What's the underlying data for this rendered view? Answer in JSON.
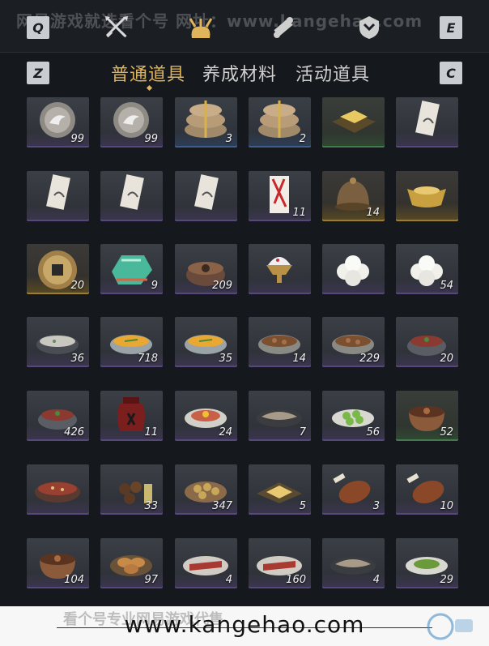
{
  "watermark": "网易游戏就选看个号 网址：www.kangehao.com",
  "keys": {
    "q": "Q",
    "e": "E",
    "z": "Z",
    "c": "C"
  },
  "top_icons": [
    "crossed-swords-icon",
    "bundle-icon",
    "scroll-icon",
    "shield-icon"
  ],
  "tabs": [
    {
      "label": "普通道具",
      "active": true
    },
    {
      "label": "养成材料",
      "active": false
    },
    {
      "label": "活动道具",
      "active": false
    }
  ],
  "colors": {
    "accent": "#e0b45a",
    "rarity_purple": "#8c6ec8",
    "rarity_gold": "#d2aa3c",
    "rarity_green": "#5aaa64"
  },
  "items": [
    {
      "icon": "dove-coin-icon",
      "count": "99",
      "rarity": "purple"
    },
    {
      "icon": "dove-coin-icon",
      "count": "99",
      "rarity": "purple"
    },
    {
      "icon": "rice-bundle-icon",
      "count": "3",
      "rarity": "blue"
    },
    {
      "icon": "rice-bundle-icon",
      "count": "2",
      "rarity": "blue"
    },
    {
      "icon": "golden-cloth-icon",
      "count": "",
      "rarity": "green"
    },
    {
      "icon": "letter-card-icon",
      "count": "",
      "rarity": "purple"
    },
    {
      "icon": "letter-card-icon",
      "count": "",
      "rarity": "purple"
    },
    {
      "icon": "letter-card-icon",
      "count": "",
      "rarity": "purple"
    },
    {
      "icon": "letter-card-icon",
      "count": "",
      "rarity": "purple"
    },
    {
      "icon": "red-envelope-icon",
      "count": "11",
      "rarity": "purple"
    },
    {
      "icon": "bronze-helmet-icon",
      "count": "14",
      "rarity": "gold"
    },
    {
      "icon": "gold-ingot-icon",
      "count": "",
      "rarity": "gold"
    },
    {
      "icon": "square-hole-coin-icon",
      "count": "20",
      "rarity": "gold"
    },
    {
      "icon": "jade-stone-icon",
      "count": "9",
      "rarity": "purple"
    },
    {
      "icon": "stew-pot-icon",
      "count": "209",
      "rarity": "purple"
    },
    {
      "icon": "shaved-ice-icon",
      "count": "",
      "rarity": "purple"
    },
    {
      "icon": "steamed-buns-icon",
      "count": "",
      "rarity": "purple"
    },
    {
      "icon": "steamed-buns-icon",
      "count": "54",
      "rarity": "purple"
    },
    {
      "icon": "porridge-bowl-icon",
      "count": "36",
      "rarity": "purple"
    },
    {
      "icon": "egg-soup-icon",
      "count": "718",
      "rarity": "purple"
    },
    {
      "icon": "egg-soup-icon",
      "count": "35",
      "rarity": "purple"
    },
    {
      "icon": "braised-meat-icon",
      "count": "14",
      "rarity": "purple"
    },
    {
      "icon": "braised-meat-icon",
      "count": "229",
      "rarity": "purple"
    },
    {
      "icon": "meat-bowl-icon",
      "count": "20",
      "rarity": "purple"
    },
    {
      "icon": "meat-bowl-icon",
      "count": "426",
      "rarity": "purple"
    },
    {
      "icon": "wine-jar-icon",
      "count": "11",
      "rarity": "purple"
    },
    {
      "icon": "egg-dish-icon",
      "count": "24",
      "rarity": "purple"
    },
    {
      "icon": "fish-plate-icon",
      "count": "7",
      "rarity": "purple"
    },
    {
      "icon": "okra-plate-icon",
      "count": "56",
      "rarity": "purple"
    },
    {
      "icon": "clay-pot-icon",
      "count": "52",
      "rarity": "green"
    },
    {
      "icon": "hotpot-icon",
      "count": "",
      "rarity": "purple"
    },
    {
      "icon": "pills-icon",
      "count": "33",
      "rarity": "purple"
    },
    {
      "icon": "dumpling-basket-icon",
      "count": "347",
      "rarity": "purple"
    },
    {
      "icon": "noodle-plate-icon",
      "count": "5",
      "rarity": "purple"
    },
    {
      "icon": "meat-leg-icon",
      "count": "3",
      "rarity": "purple"
    },
    {
      "icon": "meat-leg-icon",
      "count": "10",
      "rarity": "purple"
    },
    {
      "icon": "clay-pot-icon",
      "count": "104",
      "rarity": "purple"
    },
    {
      "icon": "bread-basket-icon",
      "count": "97",
      "rarity": "purple"
    },
    {
      "icon": "sliced-meat-icon",
      "count": "4",
      "rarity": "purple"
    },
    {
      "icon": "sliced-meat-icon",
      "count": "160",
      "rarity": "purple"
    },
    {
      "icon": "fish-plate-icon",
      "count": "4",
      "rarity": "purple"
    },
    {
      "icon": "greens-plate-icon",
      "count": "29",
      "rarity": "purple"
    }
  ],
  "footer": {
    "url": "www.kangehao.com",
    "ghost": "看个号专业网易游戏代售"
  }
}
